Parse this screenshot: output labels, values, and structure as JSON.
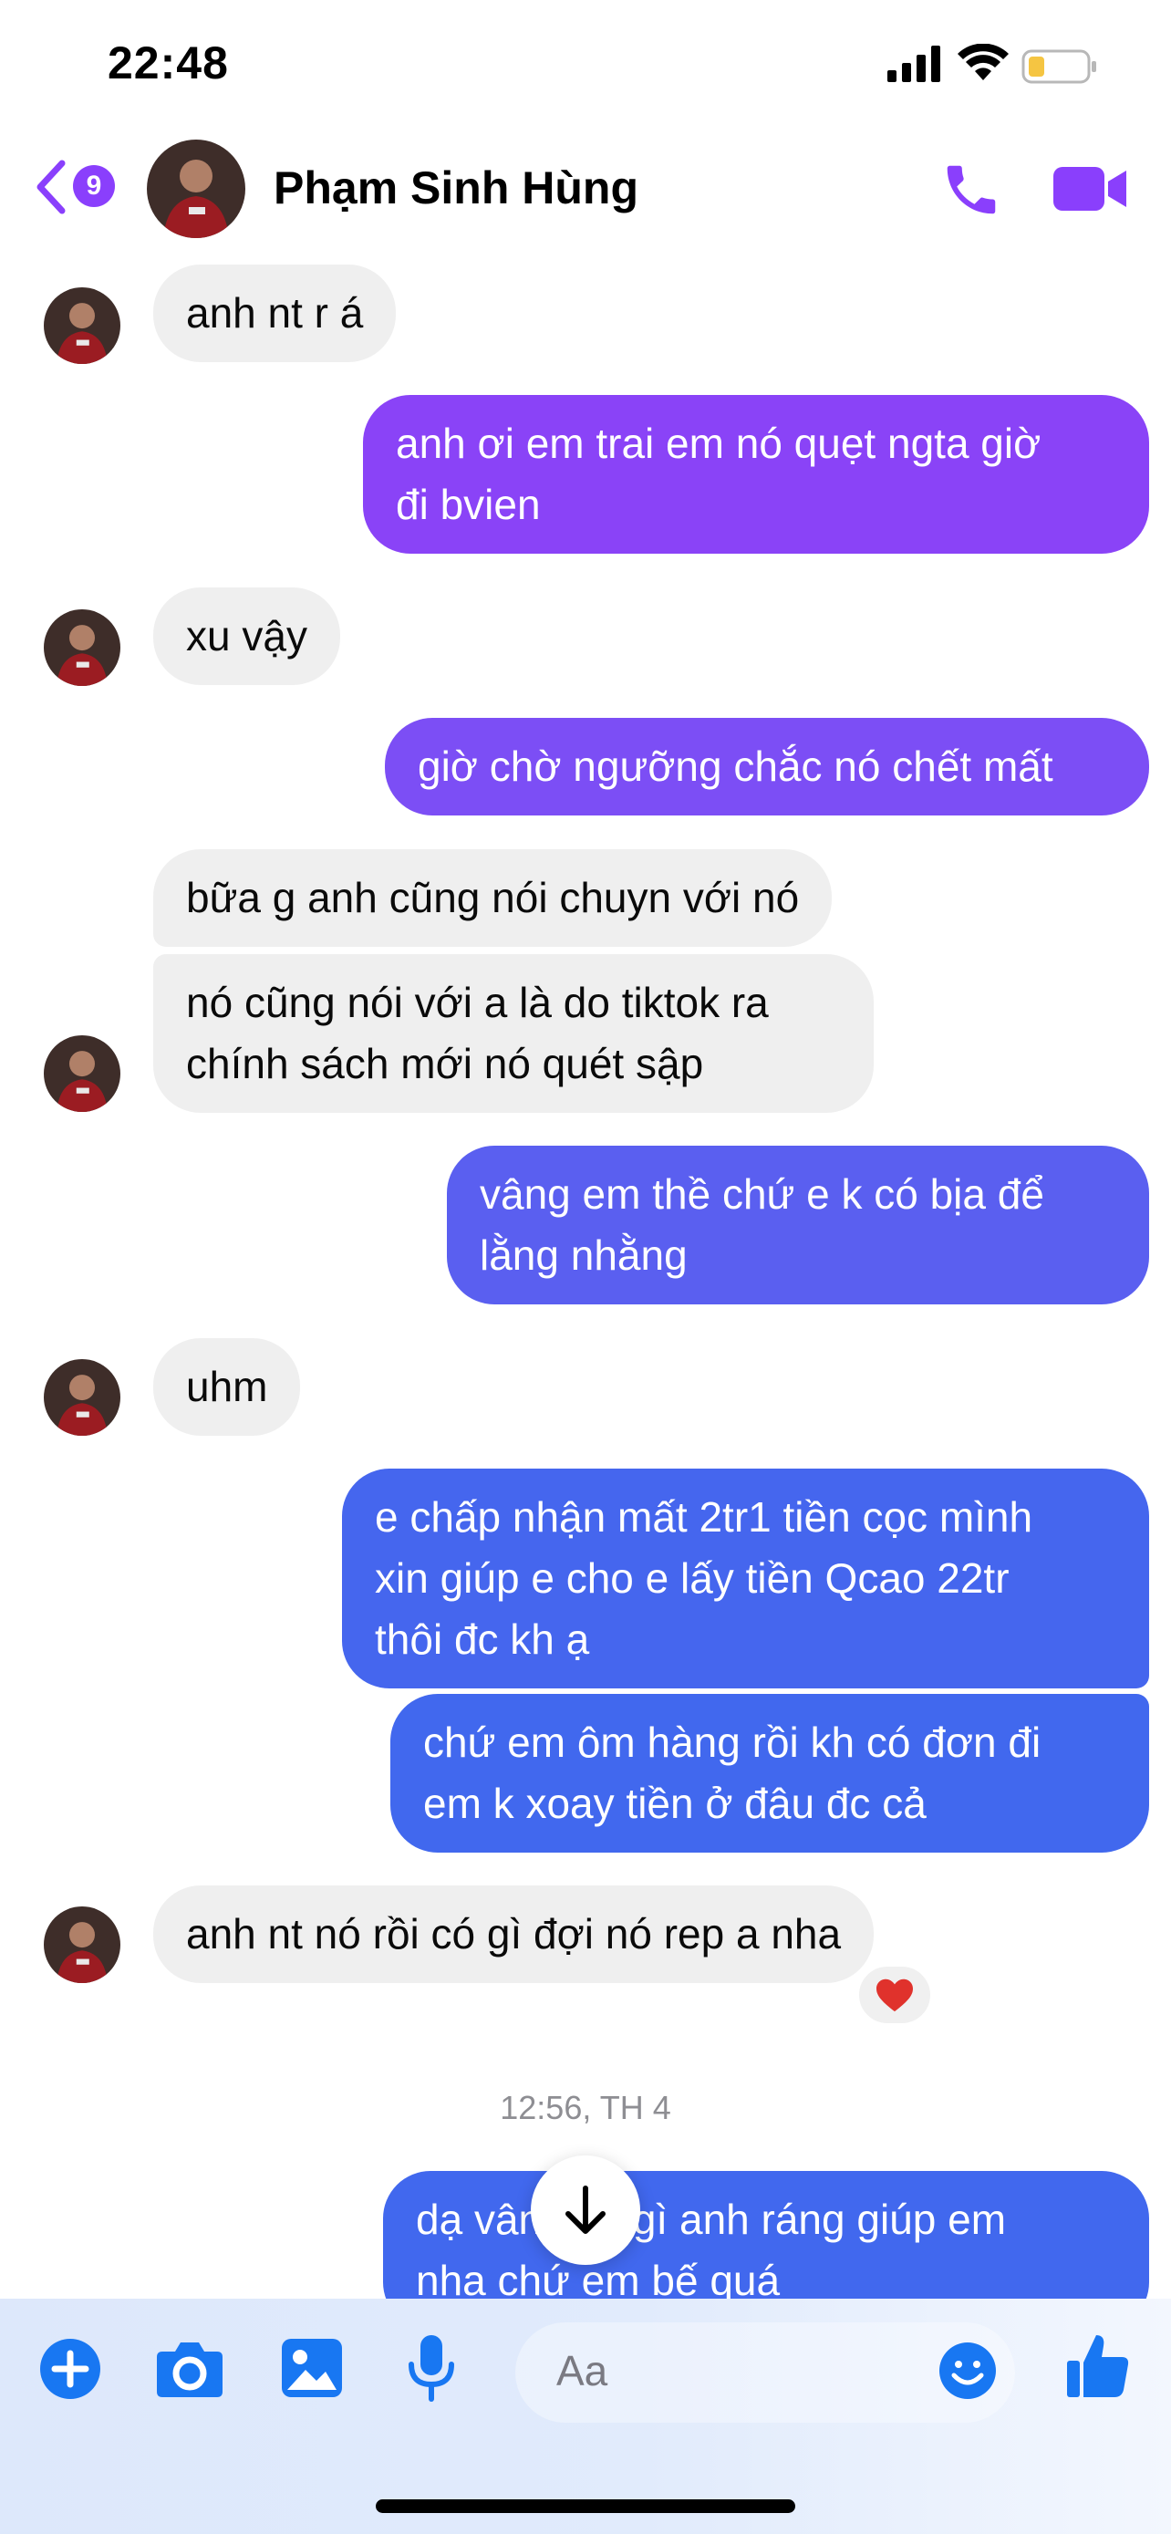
{
  "status_bar": {
    "time": "22:48"
  },
  "header": {
    "unread_count": "9",
    "contact_name": "Phạm Sinh Hùng"
  },
  "messages": [
    {
      "dir": "in",
      "lines": [
        "anh nt r á"
      ]
    },
    {
      "dir": "out",
      "lines": [
        "anh ơi em trai em nó quẹt ngta giờ",
        "đi bvien"
      ]
    },
    {
      "dir": "in",
      "lines": [
        "xu vậy"
      ]
    },
    {
      "dir": "out",
      "lines": [
        "giờ chờ ngưỡng chắc nó chết mất"
      ]
    },
    {
      "dir": "in",
      "lines": [
        "bữa g anh cũng nói chuyn với nó"
      ]
    },
    {
      "dir": "in",
      "lines": [
        "nó cũng nói với a là do tiktok ra",
        "chính sách mới nó quét sập"
      ]
    },
    {
      "dir": "out",
      "lines": [
        "vâng em thề chứ e k có bịa để",
        "lằng nhằng"
      ]
    },
    {
      "dir": "in",
      "lines": [
        "uhm"
      ]
    },
    {
      "dir": "out",
      "lines": [
        "e chấp nhận mất 2tr1 tiền cọc mình",
        "xin giúp e cho e lấy tiền Qcao 22tr",
        "thôi đc kh ạ"
      ]
    },
    {
      "dir": "out",
      "lines": [
        "chứ em ôm hàng rồi kh có đơn đi",
        "em k xoay tiền ở đâu đc cả"
      ]
    },
    {
      "dir": "in",
      "lines": [
        "anh nt nó rồi có gì đợi nó rep a nha"
      ]
    },
    {
      "dir": "out",
      "lines": [
        "dạ vâng có gì anh ráng giúp em",
        "nha chứ em bế quá"
      ]
    }
  ],
  "reaction": {
    "icon": "heart-icon",
    "color": "#e0322c"
  },
  "timestamp": "12:56, TH 4",
  "composer": {
    "placeholder": "Aa"
  },
  "colors": {
    "accent": "#8a3ffc",
    "incoming_bubble": "#efefef",
    "outgoing_gradient": [
      "#8a43f7",
      "#7c4ef5",
      "#5a5ff0",
      "#4566ee",
      "#4168ee"
    ],
    "composer_icon": "#1877f2"
  }
}
